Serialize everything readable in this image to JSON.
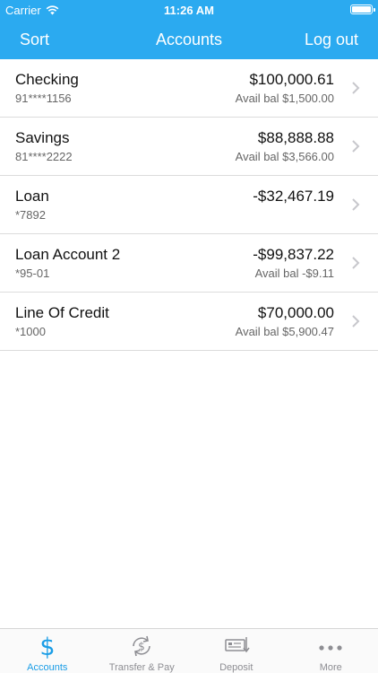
{
  "status_bar": {
    "carrier": "Carrier",
    "time": "11:26 AM"
  },
  "nav": {
    "left": "Sort",
    "title": "Accounts",
    "right": "Log out"
  },
  "accounts": [
    {
      "name": "Checking",
      "number": "91****1156",
      "balance": "$100,000.61",
      "avail": "Avail bal $1,500.00"
    },
    {
      "name": "Savings",
      "number": "81****2222",
      "balance": "$88,888.88",
      "avail": "Avail bal $3,566.00"
    },
    {
      "name": "Loan",
      "number": "*7892",
      "balance": "-$32,467.19",
      "avail": ""
    },
    {
      "name": "Loan Account 2",
      "number": "*95-01",
      "balance": "-$99,837.22",
      "avail": "Avail bal -$9.11"
    },
    {
      "name": "Line Of Credit",
      "number": "*1000",
      "balance": "$70,000.00",
      "avail": "Avail bal $5,900.47"
    }
  ],
  "tabs": [
    {
      "label": "Accounts",
      "icon": "dollar-icon",
      "active": true
    },
    {
      "label": "Transfer & Pay",
      "icon": "transfer-icon"
    },
    {
      "label": "Deposit",
      "icon": "check-deposit-icon"
    },
    {
      "label": "More",
      "icon": "more-dots-icon"
    }
  ],
  "colors": {
    "header": "#2baaf0",
    "active_tab": "#1a9de6",
    "inactive_tab": "#8e8e93"
  }
}
